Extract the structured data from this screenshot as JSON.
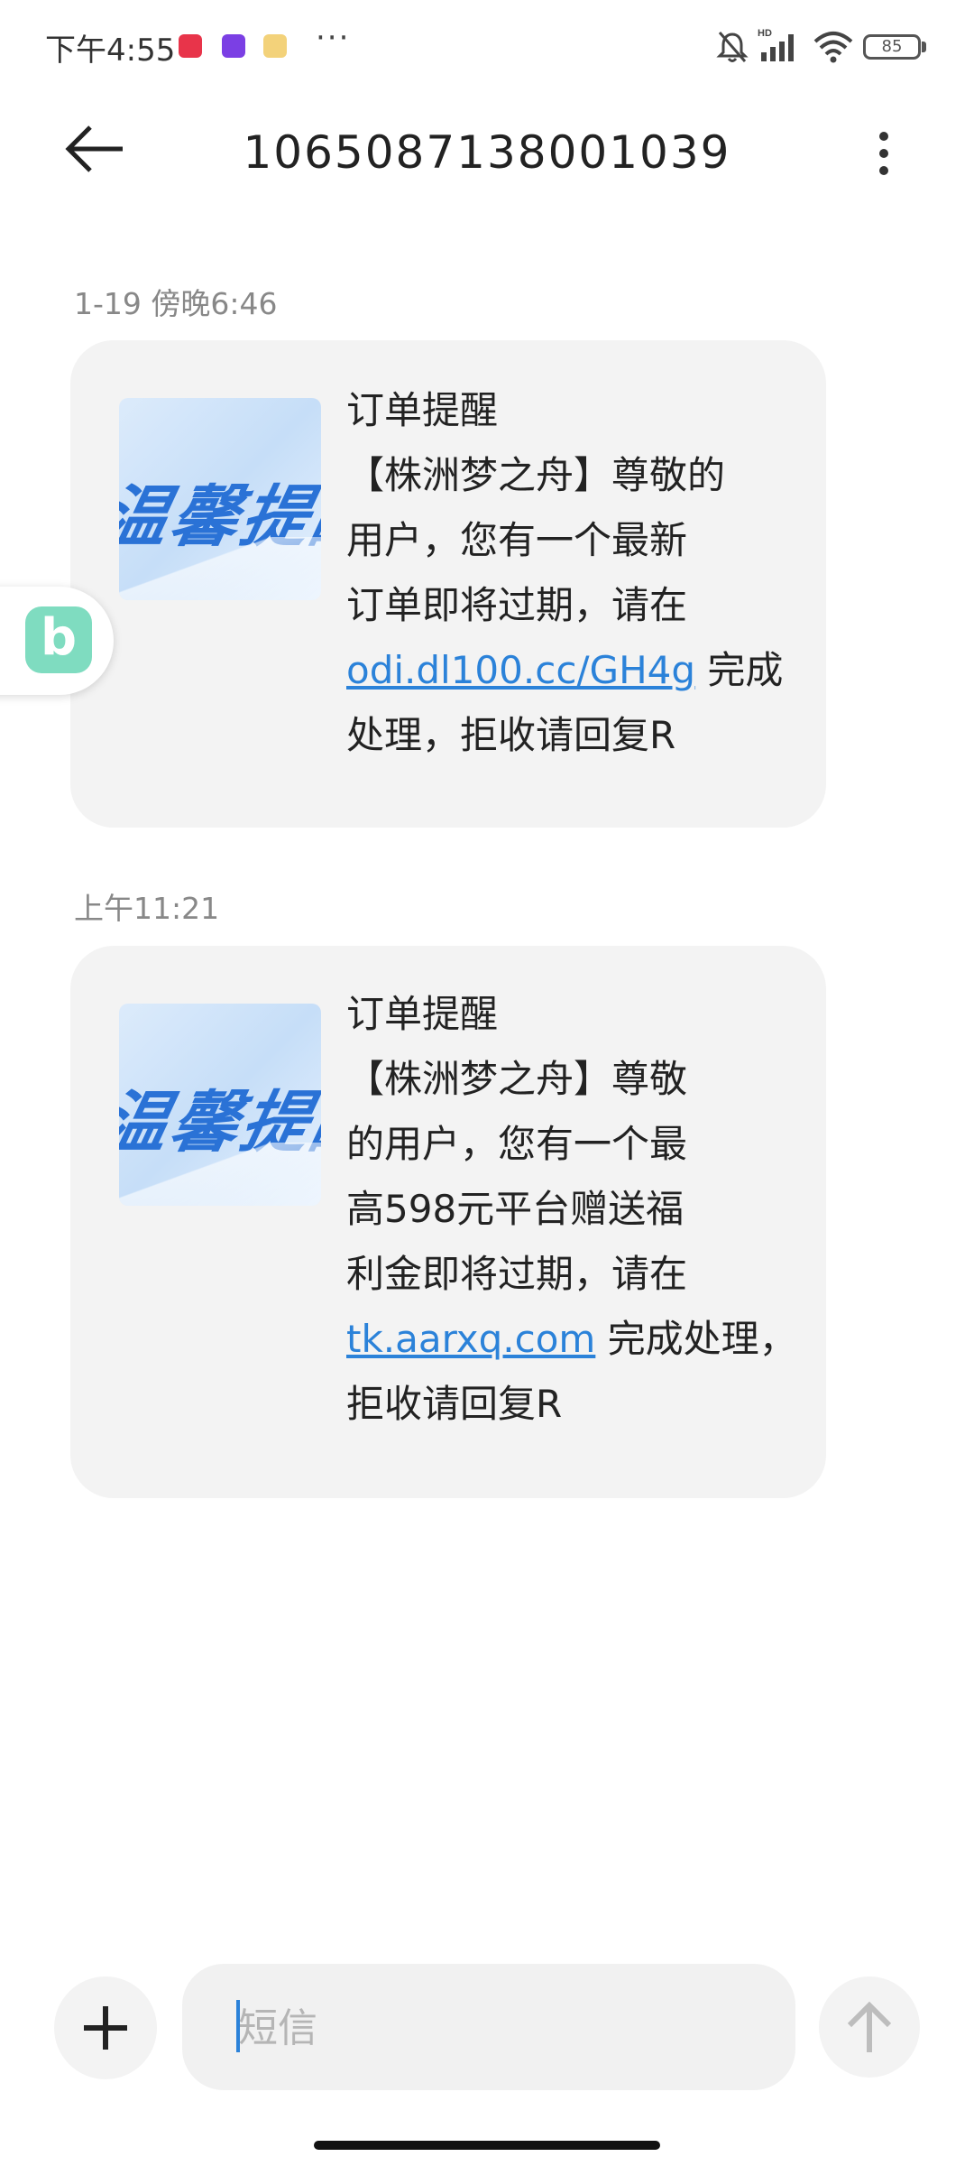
{
  "status_bar": {
    "time": "下午4:55",
    "more": "···",
    "battery": "85"
  },
  "header": {
    "title": "1065087138001039"
  },
  "messages": [
    {
      "timestamp": "1-19 傍晚6:46",
      "thumbnail_text": "温馨提醒",
      "lines": [
        "订单提醒",
        "【株洲梦之舟】尊敬的",
        "用户，您有一个最新",
        "订单即将过期，请在"
      ],
      "link": "odi.dl100.cc/GH4g",
      "after_link": " 完成",
      "tail_lines": [
        "处理，拒收请回复R"
      ]
    },
    {
      "timestamp": "上午11:21",
      "thumbnail_text": "温馨提醒",
      "lines": [
        "订单提醒",
        "【株洲梦之舟】尊敬",
        "的用户，您有一个最",
        "高598元平台赠送福",
        "利金即将过期，请在"
      ],
      "link": "tk.aarxq.com",
      "after_link": " 完成处理，",
      "tail_lines": [
        "拒收请回复R"
      ]
    }
  ],
  "floating_widget": {
    "label": "b"
  },
  "composer": {
    "placeholder": "短信"
  },
  "colors": {
    "link": "#2b82d9",
    "bubble": "#f3f3f3"
  }
}
